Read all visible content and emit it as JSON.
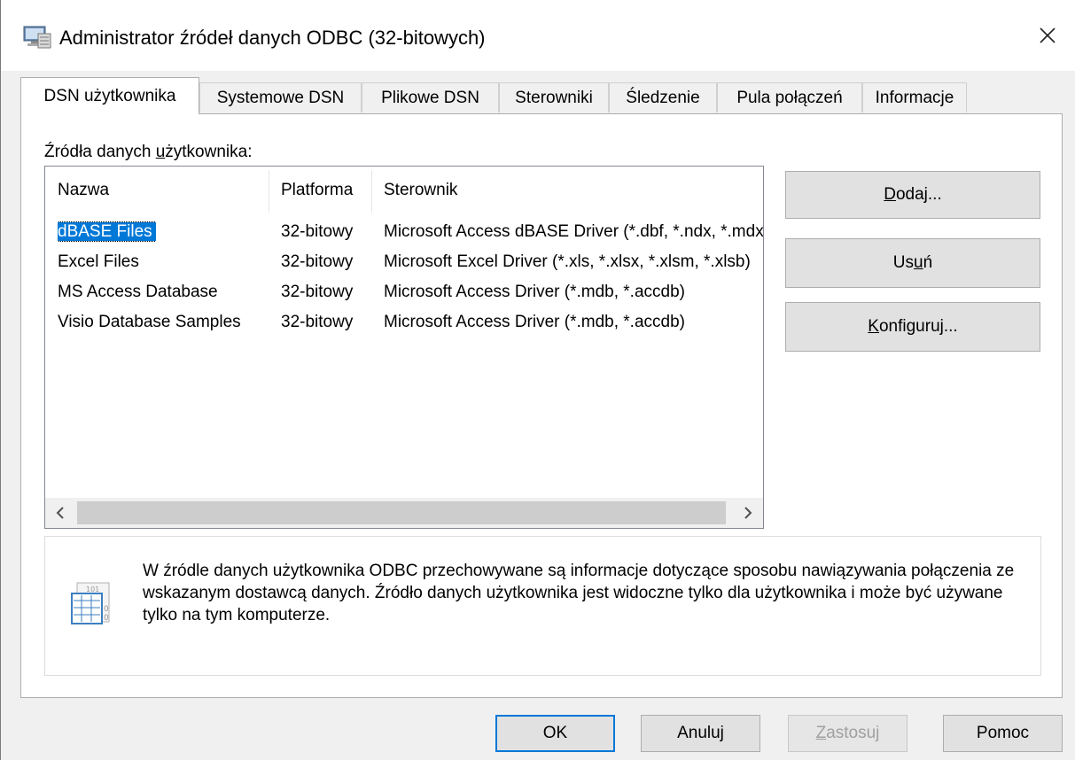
{
  "window": {
    "title": "Administrator źródeł danych ODBC (32-bitowych)"
  },
  "icons": {
    "app": "odbc-admin-icon",
    "close": "close-icon",
    "info": "database-info-icon",
    "scroll_left": "chevron-left-icon",
    "scroll_right": "chevron-right-icon"
  },
  "tabs": [
    {
      "label": "DSN użytkownika",
      "active": true
    },
    {
      "label": "Systemowe DSN"
    },
    {
      "label": "Plikowe DSN"
    },
    {
      "label": "Sterowniki"
    },
    {
      "label": "Śledzenie"
    },
    {
      "label": "Pula połączeń"
    },
    {
      "label": "Informacje"
    }
  ],
  "panel": {
    "group_label": {
      "pre": "Źródła danych ",
      "accel": "u",
      "post": "żytkownika:"
    },
    "columns": [
      "Nazwa",
      "Platforma",
      "Sterownik"
    ],
    "rows": [
      {
        "name": "dBASE Files",
        "platform": "32-bitowy",
        "driver": "Microsoft Access dBASE Driver (*.dbf, *.ndx, *.mdx)",
        "selected": true
      },
      {
        "name": "Excel Files",
        "platform": "32-bitowy",
        "driver": "Microsoft Excel Driver (*.xls, *.xlsx, *.xlsm, *.xlsb)"
      },
      {
        "name": "MS Access Database",
        "platform": "32-bitowy",
        "driver": "Microsoft Access Driver (*.mdb, *.accdb)"
      },
      {
        "name": "Visio Database Samples",
        "platform": "32-bitowy",
        "driver": "Microsoft Access Driver (*.mdb, *.accdb)"
      }
    ],
    "buttons": {
      "add": {
        "accel": "D",
        "rest": "odaj..."
      },
      "remove": {
        "pre": "Us",
        "accel": "u",
        "post": "ń"
      },
      "configure": {
        "accel": "K",
        "rest": "onfiguruj..."
      }
    },
    "info_text": "W źródle danych użytkownika ODBC przechowywane są informacje dotyczące sposobu nawiązywania połączenia ze wskazanym dostawcą danych. Źródło danych użytkownika jest widoczne tylko dla użytkownika i może być używane tylko na tym komputerze."
  },
  "footer": {
    "ok": "OK",
    "cancel": "Anuluj",
    "apply": {
      "accel": "Z",
      "rest": "astosuj"
    },
    "help": "Pomoc"
  }
}
